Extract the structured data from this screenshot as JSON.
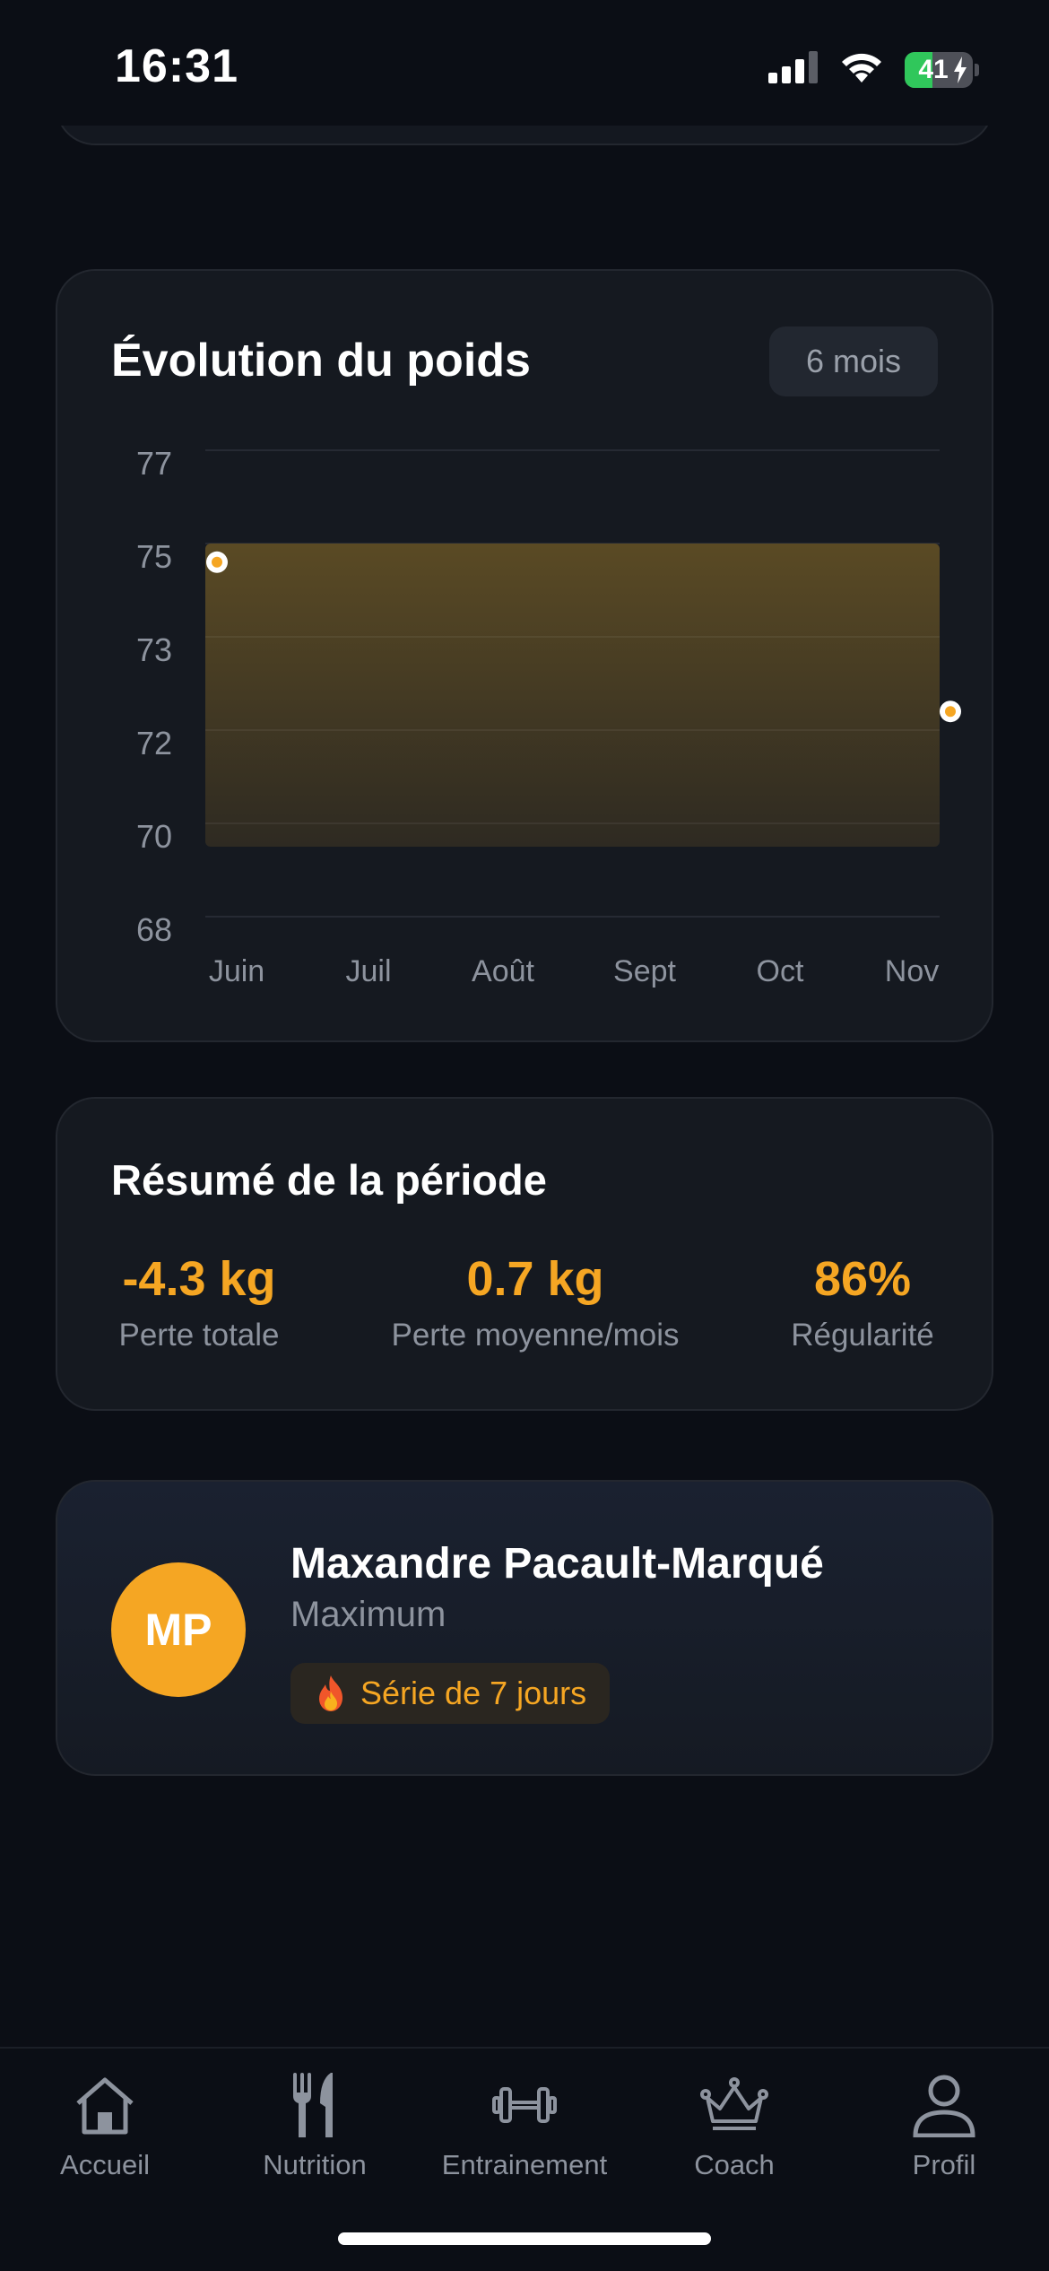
{
  "status_bar": {
    "time": "16:31",
    "battery_percent": "41",
    "battery_level": 0.41,
    "charging": true,
    "icons": [
      "cellular-signal-icon",
      "wifi-icon",
      "battery-charging-icon"
    ]
  },
  "colors": {
    "background": "#0b0e15",
    "card": "#151920",
    "accent": "#f5a623",
    "muted_text": "#8d939e",
    "battery_green": "#30c75b"
  },
  "weight_card": {
    "title": "Évolution du poids",
    "period": "6 mois"
  },
  "chart_data": {
    "type": "area",
    "title": "Évolution du poids",
    "y_ticks": [
      "77",
      "75",
      "73",
      "72",
      "70",
      "68"
    ],
    "x": [
      "Juin",
      "Juil",
      "Août",
      "Sept",
      "Oct",
      "Nov"
    ],
    "series": [
      {
        "points": [
          {
            "x": "Juin",
            "y": 74.6
          },
          {
            "x": "Nov",
            "y": 72.2
          }
        ]
      }
    ],
    "area_top": 75,
    "area_bottom": 69.5,
    "grid": true,
    "accent_color": "#f5a623"
  },
  "summary": {
    "title": "Résumé de la période",
    "stats": [
      {
        "value": "-4.3 kg",
        "label": "Perte totale"
      },
      {
        "value": "0.7 kg",
        "label": "Perte moyenne/mois"
      },
      {
        "value": "86%",
        "label": "Régularité"
      }
    ]
  },
  "profile": {
    "initials": "MP",
    "name": "Maxandre Pacault-Marqué",
    "plan": "Maximum",
    "streak_icon": "fire-icon",
    "streak_text": "Série de 7 jours"
  },
  "tabs": [
    {
      "label": "Accueil",
      "icon": "home-icon"
    },
    {
      "label": "Nutrition",
      "icon": "fork-knife-icon"
    },
    {
      "label": "Entrainement",
      "icon": "dumbbell-icon"
    },
    {
      "label": "Coach",
      "icon": "crown-icon"
    },
    {
      "label": "Profil",
      "icon": "person-icon"
    }
  ]
}
